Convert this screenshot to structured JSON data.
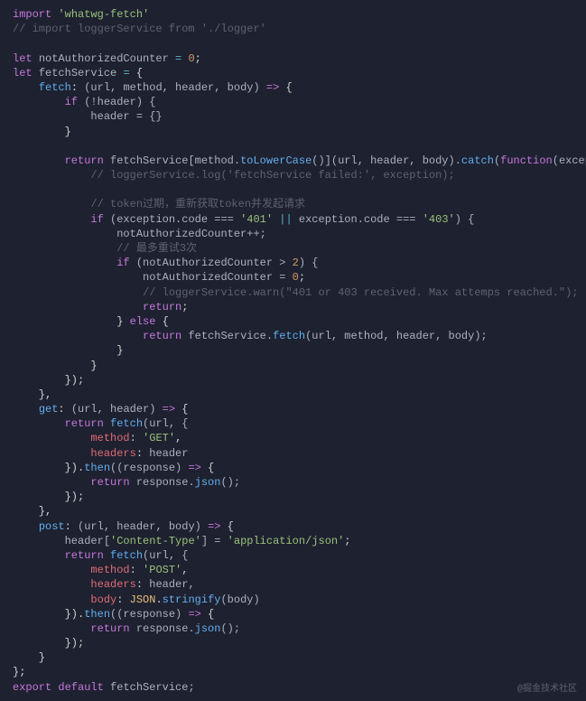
{
  "code": {
    "l1_import": "import",
    "l1_str": "'whatwg-fetch'",
    "l2_cmt": "// import loggerService from './logger'",
    "l4_let": "let",
    "l4_var": "notAuthorizedCounter",
    "l4_eq": "=",
    "l4_num": "0",
    "l5_let": "let",
    "l5_var": "fetchService",
    "l5_eq": "=",
    "l6_fetch": "fetch",
    "l6_params": "(url, method, header, body)",
    "l6_arrow": "=>",
    "l7_if": "if",
    "l7_cond": "(!header) {",
    "l8_assign": "header = {}",
    "l11_return": "return",
    "l11_a": "fetchService[method.",
    "l11_toLower": "toLowerCase",
    "l11_b": "()](url, header, body).",
    "l11_catch": "catch",
    "l11_c": "(",
    "l11_function": "function",
    "l11_d": "(exception) {",
    "l12_cmt": "// loggerService.log('fetchService failed:', exception);",
    "l14_cmt": "// token过期，重新获取token并发起请求",
    "l15_if": "if",
    "l15_a": "(exception.code ===",
    "l15_s1": "'401'",
    "l15_or": "||",
    "l15_b": "exception.code ===",
    "l15_s2": "'403'",
    "l15_c": ") {",
    "l16": "notAuthorizedCounter++;",
    "l17_cmt": "// 最多重试3次",
    "l18_if": "if",
    "l18_a": "(notAuthorizedCounter >",
    "l18_num": "2",
    "l18_b": ") {",
    "l19_a": "notAuthorizedCounter =",
    "l19_num": "0",
    "l20_cmt": "// loggerService.warn(\"401 or 403 received. Max attemps reached.\");",
    "l21_return": "return",
    "l22_else": "else",
    "l23_return": "return",
    "l23_a": "fetchService.",
    "l23_fetch": "fetch",
    "l23_b": "(url, method, header, body);",
    "l28_get": "get",
    "l28_params": "(url, header)",
    "l28_arrow": "=>",
    "l29_return": "return",
    "l29_fetch": "fetch",
    "l29_a": "(url, {",
    "l30_method": "method",
    "l30_val": "'GET'",
    "l31_headers": "headers",
    "l31_val": "header",
    "l32_then": "then",
    "l32_a": "((response)",
    "l32_arrow": "=>",
    "l33_return": "return",
    "l33_a": "response.",
    "l33_json": "json",
    "l33_b": "();",
    "l36_post": "post",
    "l36_params": "(url, header, body)",
    "l36_arrow": "=>",
    "l37_a": "header[",
    "l37_s1": "'Content-Type'",
    "l37_b": "] =",
    "l37_s2": "'application/json'",
    "l38_return": "return",
    "l38_fetch": "fetch",
    "l38_a": "(url, {",
    "l39_method": "method",
    "l39_val": "'POST'",
    "l40_headers": "headers",
    "l40_val": "header,",
    "l41_body": "body",
    "l41_json": "JSON",
    "l41_stringify": "stringify",
    "l41_a": "(body)",
    "l42_then": "then",
    "l42_a": "((response)",
    "l42_arrow": "=>",
    "l43_return": "return",
    "l43_a": "response.",
    "l43_json": "json",
    "l43_b": "();",
    "l47_export": "export",
    "l47_default": "default",
    "l47_var": "fetchService;"
  },
  "watermark": "@掘金技术社区"
}
